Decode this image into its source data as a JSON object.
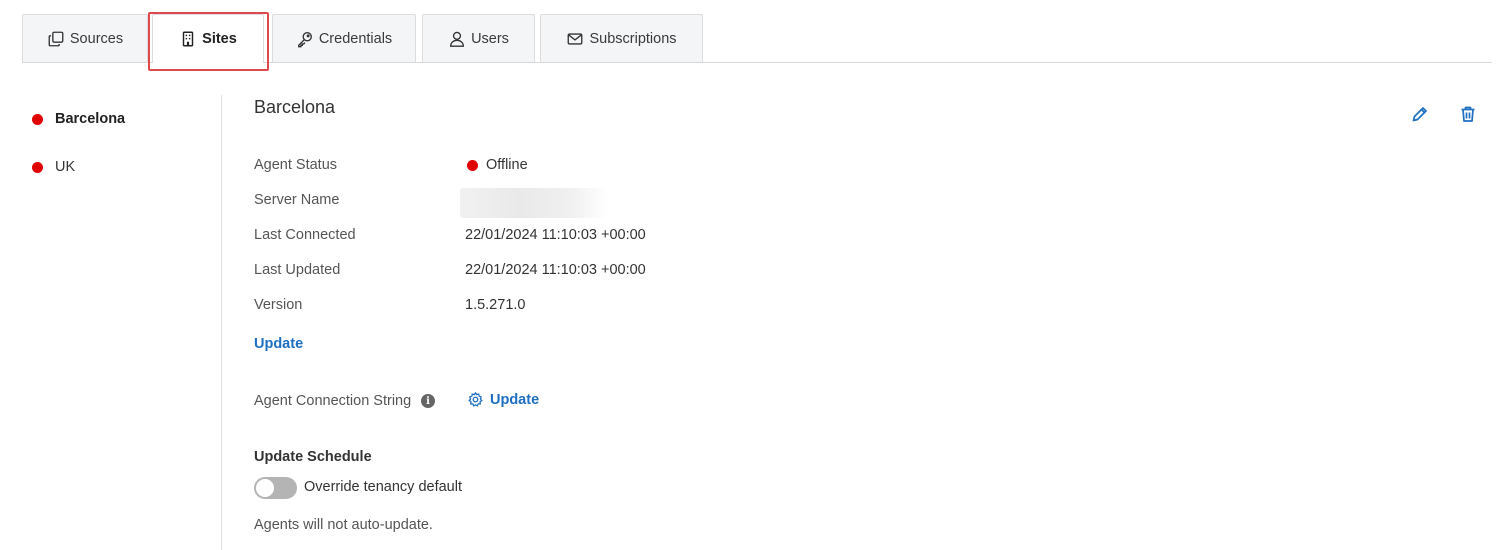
{
  "tabs": [
    {
      "label": "Sources",
      "icon": "copy-icon"
    },
    {
      "label": "Sites",
      "icon": "building-icon",
      "active": true
    },
    {
      "label": "Credentials",
      "icon": "key-icon"
    },
    {
      "label": "Users",
      "icon": "user-icon"
    },
    {
      "label": "Subscriptions",
      "icon": "envelope-icon"
    }
  ],
  "sites": [
    {
      "name": "Barcelona",
      "status_color": "#e00000",
      "selected": true
    },
    {
      "name": "UK",
      "status_color": "#e00000"
    }
  ],
  "detail": {
    "title": "Barcelona",
    "edit_icon": "pencil-icon",
    "delete_icon": "trash-icon",
    "fields": {
      "agent_status": {
        "label": "Agent Status",
        "value": "Offline",
        "status_color": "#e00000"
      },
      "server_name": {
        "label": "Server Name"
      },
      "last_connected": {
        "label": "Last Connected",
        "value": "22/01/2024 11:10:03 +00:00"
      },
      "last_updated": {
        "label": "Last Updated",
        "value": "22/01/2024 11:10:03 +00:00"
      },
      "version": {
        "label": "Version",
        "value": "1.5.271.0"
      }
    },
    "update_link": "Update",
    "connection_string": {
      "label": "Agent Connection String",
      "info_icon": "info-icon",
      "action_icon": "gear-icon",
      "action_label": "Update"
    },
    "update_schedule": {
      "title": "Update Schedule",
      "toggle_label": "Override tenancy default",
      "toggle_on": false,
      "note": "Agents will not auto-update."
    }
  },
  "colors": {
    "accent": "#1f6fc1",
    "offline": "#e00000",
    "highlight": "#e0494c"
  }
}
